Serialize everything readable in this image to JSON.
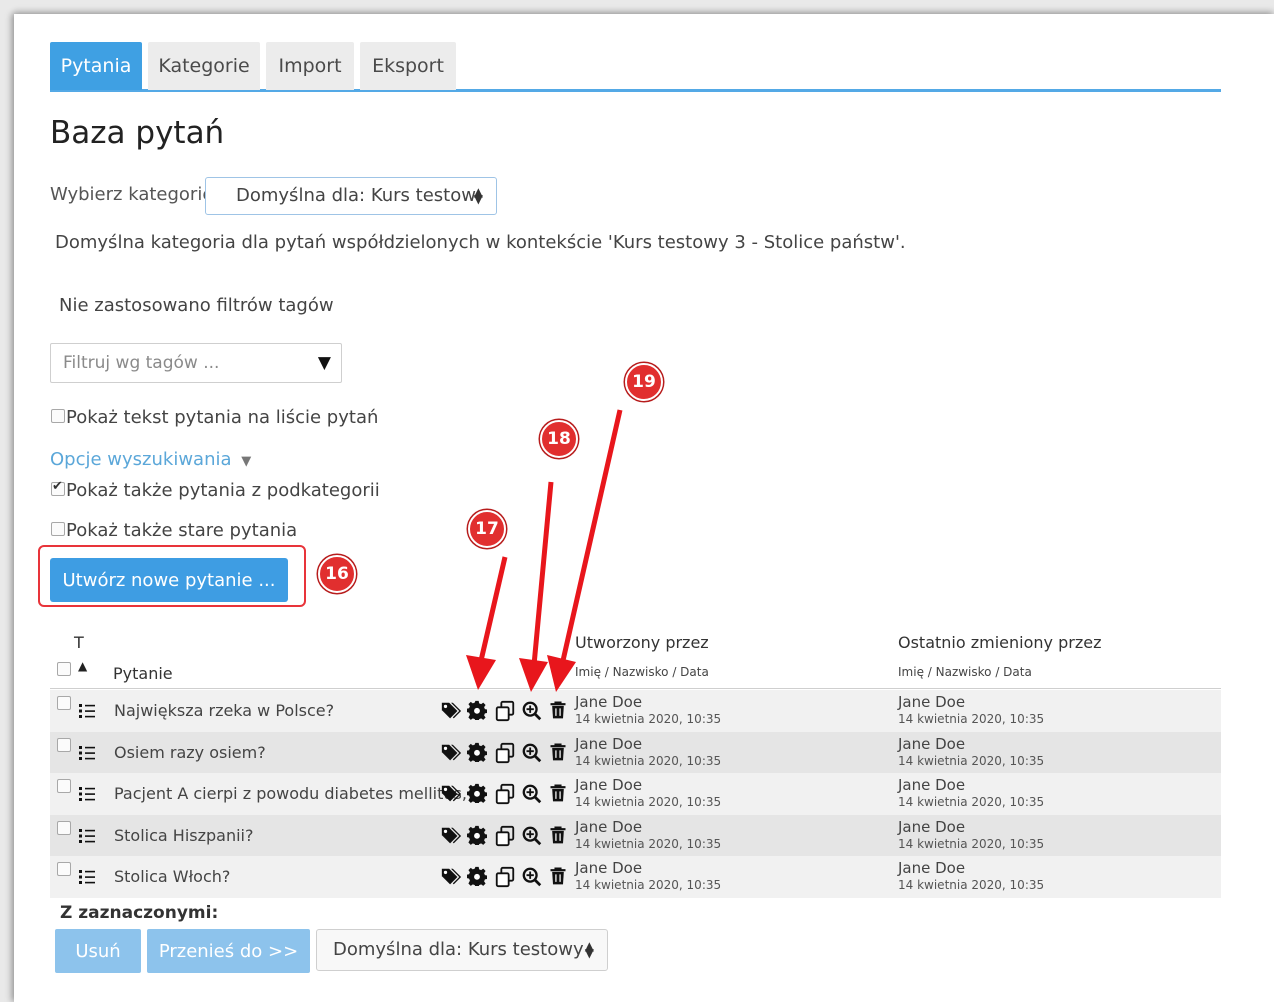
{
  "tabs": [
    "Pytania",
    "Kategorie",
    "Import",
    "Eksport"
  ],
  "page_title": "Baza pytań",
  "category": {
    "label": "Wybierz kategorię",
    "selected": "Domyślna dla: Kurs testow",
    "description": "Domyślna kategoria dla pytań współdzielonych w kontekście 'Kurs testowy 3 - Stolice państw'."
  },
  "tags": {
    "status": "Nie zastosowano filtrów tagów",
    "placeholder": "Filtruj wg tagów ...",
    "arrow": "▼"
  },
  "options": {
    "show_text": "Pokaż tekst pytania na liście pytań",
    "search_options": "Opcje wyszukiwania",
    "subcategories": "Pokaż także pytania z podkategorii",
    "old_questions": "Pokaż także stare pytania"
  },
  "create_button": "Utwórz nowe pytanie ...",
  "badges": [
    "16",
    "17",
    "18",
    "19"
  ],
  "table": {
    "col_type": "T",
    "col_question": "Pytanie",
    "col_created": "Utworzony przez",
    "col_created_sub": "Imię / Nazwisko / Data",
    "col_modified": "Ostatnio zmieniony przez",
    "col_modified_sub": "Imię / Nazwisko / Data",
    "rows": [
      {
        "question": "Największa rzeka w Polsce?",
        "created_by": "Jane Doe",
        "created_date": "14 kwietnia 2020, 10:35",
        "modified_by": "Jane Doe",
        "modified_date": "14 kwietnia 2020, 10:35"
      },
      {
        "question": "Osiem razy osiem?",
        "created_by": "Jane Doe",
        "created_date": "14 kwietnia 2020, 10:35",
        "modified_by": "Jane Doe",
        "modified_date": "14 kwietnia 2020, 10:35"
      },
      {
        "question": "Pacjent A cierpi z powodu diabetes mellitus,",
        "created_by": "Jane Doe",
        "created_date": "14 kwietnia 2020, 10:35",
        "modified_by": "Jane Doe",
        "modified_date": "14 kwietnia 2020, 10:35"
      },
      {
        "question": "Stolica Hiszpanii?",
        "created_by": "Jane Doe",
        "created_date": "14 kwietnia 2020, 10:35",
        "modified_by": "Jane Doe",
        "modified_date": "14 kwietnia 2020, 10:35"
      },
      {
        "question": "Stolica Włoch?",
        "created_by": "Jane Doe",
        "created_date": "14 kwietnia 2020, 10:35",
        "modified_by": "Jane Doe",
        "modified_date": "14 kwietnia 2020, 10:35"
      }
    ]
  },
  "footer": {
    "label": "Z zaznaczonymi:",
    "delete": "Usuń",
    "move": "Przenieś do >>",
    "target": "Domyślna dla: Kurs testowy"
  },
  "icons": [
    "tags-icon",
    "gear-icon",
    "copy-icon",
    "zoom-in-icon",
    "trash-icon",
    "list-icon"
  ],
  "colors": {
    "primary": "#3e9de3",
    "annotation": "#e12f2f",
    "link": "#5ba7d9"
  }
}
